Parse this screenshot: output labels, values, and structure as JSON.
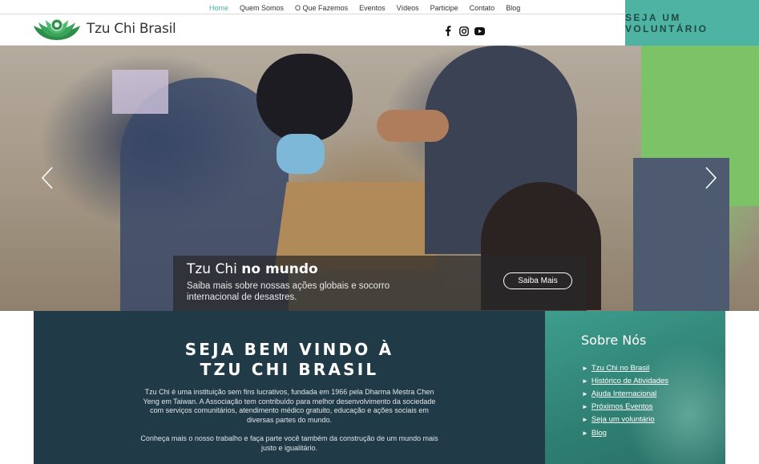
{
  "header": {
    "brand": "Tzu Chi Brasil",
    "nav": [
      "Home",
      "Quem Somos",
      "O Que Fazemos",
      "Eventos",
      "Vídeos",
      "Participe",
      "Contato",
      "Blog"
    ],
    "active_nav": "Home",
    "social_icons": [
      "facebook-icon",
      "instagram-icon",
      "youtube-icon"
    ],
    "volunteer_button": "SEJA UM VOLUNTÁRIO"
  },
  "hero": {
    "title_normal": "Tzu Chi ",
    "title_bold": "no mundo",
    "description": "Saiba mais sobre nossas ações globais e socorro internacional de desastres.",
    "button": "Saiba Mais"
  },
  "welcome": {
    "heading_line1": "SEJA BEM VINDO À",
    "heading_line2": "TZU CHI BRASIL",
    "paragraph1": "Tzu Chi é uma instituição sem fins lucrativos, fundada em 1966 pela Dharma Mestra Chen Yeng em Taiwan. A Associação tem contribuído para melhor desenvolvimento da sociedade com serviços comunitários, atendimento médico gratuito, educação e ações sociais em diversas partes do mundo.",
    "paragraph2": "Conheça mais o nosso trabalho e faça parte você também da construção de um mundo mais justo e igualitário."
  },
  "about": {
    "title": "Sobre Nós",
    "links": [
      " Tzu Chi no Brasil",
      "Histórico de Atividades",
      "Ajuda Internacional",
      "Próximos Eventos",
      "Seja um voluntário",
      "Blog"
    ]
  },
  "colors": {
    "accent": "#4fb3a3",
    "welcome_bg": "#213a48",
    "nav_active": "#47b5a8"
  }
}
